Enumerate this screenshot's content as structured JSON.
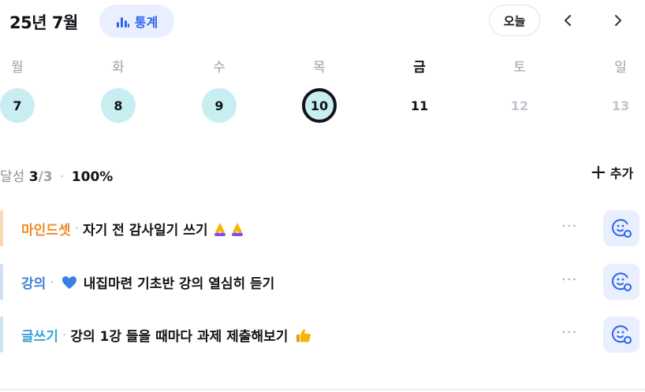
{
  "header": {
    "title": "25년 7월",
    "stats_label": "통계",
    "today_label": "오늘",
    "accent": "#2b63e8"
  },
  "week": [
    {
      "dow": "월",
      "date": "7",
      "state": "done"
    },
    {
      "dow": "화",
      "date": "8",
      "state": "done"
    },
    {
      "dow": "수",
      "date": "9",
      "state": "done"
    },
    {
      "dow": "목",
      "date": "10",
      "state": "today"
    },
    {
      "dow": "금",
      "date": "11",
      "state": "plain"
    },
    {
      "dow": "토",
      "date": "12",
      "state": "future"
    },
    {
      "dow": "일",
      "date": "13",
      "state": "future"
    }
  ],
  "summary": {
    "label": "달성",
    "done": "3",
    "slash_total": "/3",
    "percent": "100%",
    "add_label": "추가"
  },
  "tasks": [
    {
      "category": "마인드셋",
      "title": "자기 전 감사일기 쓰기",
      "emoji": "pray-icon x2",
      "color": "#f08a24"
    },
    {
      "category": "강의",
      "title": "내집마련 기초반 강의 열심히 듣기",
      "emoji": "blue-heart-icon",
      "color": "#3d7fd6"
    },
    {
      "category": "글쓰기",
      "title": "강의 1강 들을 때마다 과제 제출해보기",
      "emoji": "thumbs-up-icon",
      "color": "#3a9fd8"
    }
  ],
  "colors": {
    "done_day_bg": "#c8eef2",
    "feel_button_bg": "#e9efff"
  }
}
